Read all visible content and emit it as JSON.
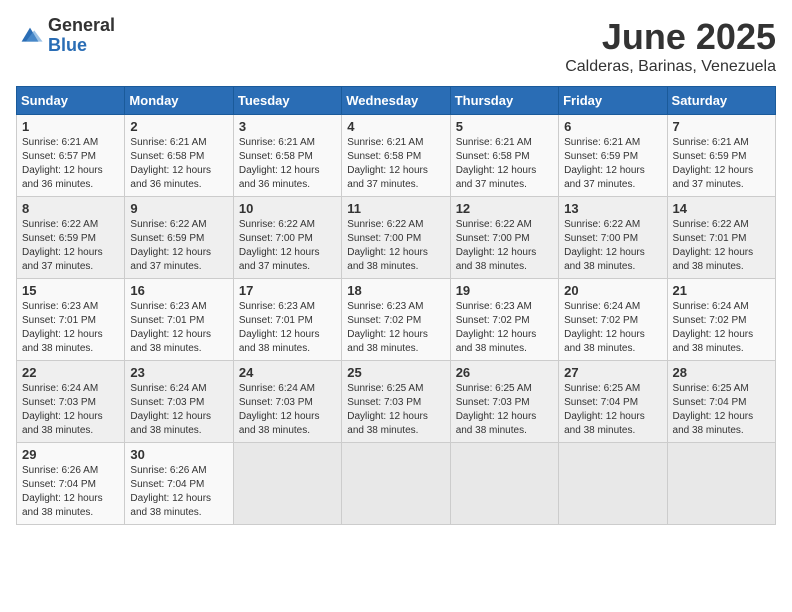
{
  "header": {
    "logo_general": "General",
    "logo_blue": "Blue",
    "title": "June 2025",
    "location": "Calderas, Barinas, Venezuela"
  },
  "calendar": {
    "days_of_week": [
      "Sunday",
      "Monday",
      "Tuesday",
      "Wednesday",
      "Thursday",
      "Friday",
      "Saturday"
    ],
    "weeks": [
      [
        null,
        {
          "day": 2,
          "sunrise": "6:21 AM",
          "sunset": "6:58 PM",
          "daylight": "12 hours and 36 minutes."
        },
        {
          "day": 3,
          "sunrise": "6:21 AM",
          "sunset": "6:58 PM",
          "daylight": "12 hours and 36 minutes."
        },
        {
          "day": 4,
          "sunrise": "6:21 AM",
          "sunset": "6:58 PM",
          "daylight": "12 hours and 37 minutes."
        },
        {
          "day": 5,
          "sunrise": "6:21 AM",
          "sunset": "6:58 PM",
          "daylight": "12 hours and 37 minutes."
        },
        {
          "day": 6,
          "sunrise": "6:21 AM",
          "sunset": "6:59 PM",
          "daylight": "12 hours and 37 minutes."
        },
        {
          "day": 7,
          "sunrise": "6:21 AM",
          "sunset": "6:59 PM",
          "daylight": "12 hours and 37 minutes."
        }
      ],
      [
        {
          "day": 1,
          "sunrise": "6:21 AM",
          "sunset": "6:57 PM",
          "daylight": "12 hours and 36 minutes."
        },
        {
          "day": 2,
          "sunrise": "6:21 AM",
          "sunset": "6:58 PM",
          "daylight": "12 hours and 36 minutes."
        },
        {
          "day": 3,
          "sunrise": "6:21 AM",
          "sunset": "6:58 PM",
          "daylight": "12 hours and 36 minutes."
        },
        {
          "day": 4,
          "sunrise": "6:21 AM",
          "sunset": "6:58 PM",
          "daylight": "12 hours and 37 minutes."
        },
        {
          "day": 5,
          "sunrise": "6:21 AM",
          "sunset": "6:58 PM",
          "daylight": "12 hours and 37 minutes."
        },
        {
          "day": 6,
          "sunrise": "6:21 AM",
          "sunset": "6:59 PM",
          "daylight": "12 hours and 37 minutes."
        },
        {
          "day": 7,
          "sunrise": "6:21 AM",
          "sunset": "6:59 PM",
          "daylight": "12 hours and 37 minutes."
        }
      ],
      [
        {
          "day": 8,
          "sunrise": "6:22 AM",
          "sunset": "6:59 PM",
          "daylight": "12 hours and 37 minutes."
        },
        {
          "day": 9,
          "sunrise": "6:22 AM",
          "sunset": "6:59 PM",
          "daylight": "12 hours and 37 minutes."
        },
        {
          "day": 10,
          "sunrise": "6:22 AM",
          "sunset": "7:00 PM",
          "daylight": "12 hours and 37 minutes."
        },
        {
          "day": 11,
          "sunrise": "6:22 AM",
          "sunset": "7:00 PM",
          "daylight": "12 hours and 38 minutes."
        },
        {
          "day": 12,
          "sunrise": "6:22 AM",
          "sunset": "7:00 PM",
          "daylight": "12 hours and 38 minutes."
        },
        {
          "day": 13,
          "sunrise": "6:22 AM",
          "sunset": "7:00 PM",
          "daylight": "12 hours and 38 minutes."
        },
        {
          "day": 14,
          "sunrise": "6:22 AM",
          "sunset": "7:01 PM",
          "daylight": "12 hours and 38 minutes."
        }
      ],
      [
        {
          "day": 15,
          "sunrise": "6:23 AM",
          "sunset": "7:01 PM",
          "daylight": "12 hours and 38 minutes."
        },
        {
          "day": 16,
          "sunrise": "6:23 AM",
          "sunset": "7:01 PM",
          "daylight": "12 hours and 38 minutes."
        },
        {
          "day": 17,
          "sunrise": "6:23 AM",
          "sunset": "7:01 PM",
          "daylight": "12 hours and 38 minutes."
        },
        {
          "day": 18,
          "sunrise": "6:23 AM",
          "sunset": "7:02 PM",
          "daylight": "12 hours and 38 minutes."
        },
        {
          "day": 19,
          "sunrise": "6:23 AM",
          "sunset": "7:02 PM",
          "daylight": "12 hours and 38 minutes."
        },
        {
          "day": 20,
          "sunrise": "6:24 AM",
          "sunset": "7:02 PM",
          "daylight": "12 hours and 38 minutes."
        },
        {
          "day": 21,
          "sunrise": "6:24 AM",
          "sunset": "7:02 PM",
          "daylight": "12 hours and 38 minutes."
        }
      ],
      [
        {
          "day": 22,
          "sunrise": "6:24 AM",
          "sunset": "7:03 PM",
          "daylight": "12 hours and 38 minutes."
        },
        {
          "day": 23,
          "sunrise": "6:24 AM",
          "sunset": "7:03 PM",
          "daylight": "12 hours and 38 minutes."
        },
        {
          "day": 24,
          "sunrise": "6:24 AM",
          "sunset": "7:03 PM",
          "daylight": "12 hours and 38 minutes."
        },
        {
          "day": 25,
          "sunrise": "6:25 AM",
          "sunset": "7:03 PM",
          "daylight": "12 hours and 38 minutes."
        },
        {
          "day": 26,
          "sunrise": "6:25 AM",
          "sunset": "7:03 PM",
          "daylight": "12 hours and 38 minutes."
        },
        {
          "day": 27,
          "sunrise": "6:25 AM",
          "sunset": "7:04 PM",
          "daylight": "12 hours and 38 minutes."
        },
        {
          "day": 28,
          "sunrise": "6:25 AM",
          "sunset": "7:04 PM",
          "daylight": "12 hours and 38 minutes."
        }
      ],
      [
        {
          "day": 29,
          "sunrise": "6:26 AM",
          "sunset": "7:04 PM",
          "daylight": "12 hours and 38 minutes."
        },
        {
          "day": 30,
          "sunrise": "6:26 AM",
          "sunset": "7:04 PM",
          "daylight": "12 hours and 38 minutes."
        },
        null,
        null,
        null,
        null,
        null
      ]
    ]
  }
}
